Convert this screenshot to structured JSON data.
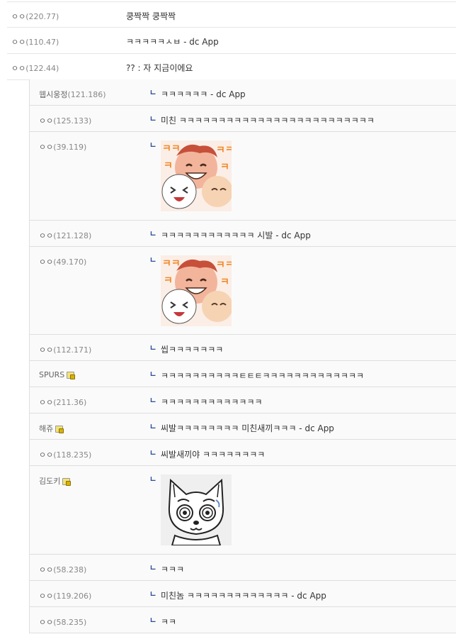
{
  "top_comments": [
    {
      "nick": "ㅇㅇ",
      "ip": "(220.77)",
      "text": "쿵짝짝 쿵짝짝"
    },
    {
      "nick": "ㅇㅇ",
      "ip": "(110.47)",
      "text": "ㅋㅋㅋㅋㅋㅅㅂ - dc App"
    },
    {
      "nick": "ㅇㅇ",
      "ip": "(122.44)",
      "text": "?? : 자 지금이에요"
    }
  ],
  "replies": [
    {
      "nick": "웹시웅정",
      "ip": "(121.186)",
      "text": "ㅋㅋㅋㅋㅋㅋ - dc App"
    },
    {
      "nick": "ㅇㅇ",
      "ip": "(125.133)",
      "text": "미친 ㅋㅋㅋㅋㅋㅋㅋㅋㅋㅋㅋㅋㅋㅋㅋㅋㅋㅋㅋㅋㅋㅋㅋㅋㅋ"
    },
    {
      "nick": "ㅇㅇ",
      "ip": "(39.119)",
      "image": "laughing-faces-sticker"
    },
    {
      "nick": "ㅇㅇ",
      "ip": "(121.128)",
      "text": "ㅋㅋㅋㅋㅋㅋㅋㅋㅋㅋㅋㅋ 시발 - dc App"
    },
    {
      "nick": "ㅇㅇ",
      "ip": "(49.170)",
      "image": "laughing-faces-sticker"
    },
    {
      "nick": "ㅇㅇ",
      "ip": "(112.171)",
      "text": "씹ㅋㅋㅋㅋㅋㅋㅋ"
    },
    {
      "nick": "SPURS",
      "ip": "",
      "lock": true,
      "text": "ㅋㅋㅋㅋㅋㅋㅋㅋㅋㅋㅌㅌㅌㅋㅋㅋㅋㅋㅋㅋㅋㅋㅋㅋㅋㅋ"
    },
    {
      "nick": "ㅇㅇ",
      "ip": "(211.36)",
      "text": "ㅋㅋㅋㅋㅋㅋㅋㅋㅋㅋㅋㅋㅋ"
    },
    {
      "nick": "해쥬",
      "ip": "",
      "lock": true,
      "text": "씨발ㅋㅋㅋㅋㅋㅋㅋㅋ 미친새끼ㅋㅋㅋ - dc App"
    },
    {
      "nick": "ㅇㅇ",
      "ip": "(118.235)",
      "text": "씨발새끼야 ㅋㅋㅋㅋㅋㅋㅋㅋ"
    },
    {
      "nick": "김도키",
      "ip": "",
      "lock": true,
      "image": "shocked-cat-sticker"
    },
    {
      "nick": "ㅇㅇ",
      "ip": "(58.238)",
      "text": "ㅋㅋㅋ"
    },
    {
      "nick": "ㅇㅇ",
      "ip": "(119.206)",
      "text": "미친놈 ㅋㅋㅋㅋㅋㅋㅋㅋㅋㅋㅋㅋㅋ - dc App"
    },
    {
      "nick": "ㅇㅇ",
      "ip": "(58.235)",
      "text": "ㅋㅋ"
    }
  ],
  "reply_mark": "ㄴ",
  "colors": {
    "reply_mark": "#2b4b9a",
    "row_border": "#e6e6e6",
    "reply_bg": "#fafafa"
  }
}
